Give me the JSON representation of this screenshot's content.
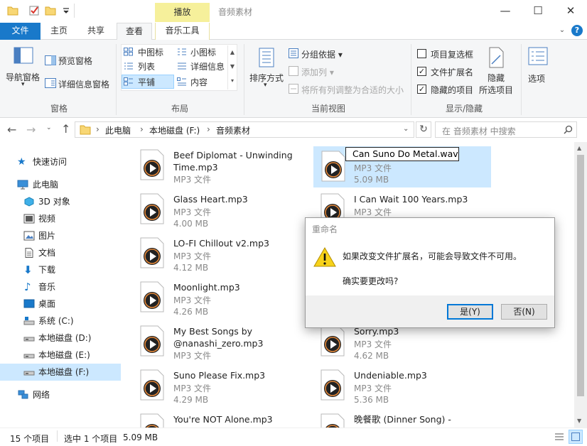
{
  "titlebar": {
    "context_tab": "播放",
    "window_title": "音频素材",
    "minimize": "—",
    "maximize": "☐",
    "close": "✕"
  },
  "ribbon_tabs": {
    "file": "文件",
    "home": "主页",
    "share": "共享",
    "view": "查看",
    "music_tools": "音乐工具"
  },
  "ribbon": {
    "panes": {
      "nav_pane": "导航窗格",
      "preview_pane": "预览窗格",
      "details_pane": "详细信息窗格",
      "label": "窗格"
    },
    "layout": {
      "medium_icons": "中图标",
      "small_icons": "小图标",
      "list": "列表",
      "details": "详细信息",
      "tiles": "平铺",
      "content": "内容",
      "label": "布局"
    },
    "current_view": {
      "sort_by": "排序方式",
      "group_by": "分组依据",
      "add_columns": "添加列",
      "size_all_columns": "将所有列调整为合适的大小",
      "label": "当前视图"
    },
    "show_hide": {
      "item_checkboxes": "项目复选框",
      "file_extensions": "文件扩展名",
      "hidden_items": "隐藏的项目",
      "hide_selected_line1": "隐藏",
      "hide_selected_line2": "所选项目",
      "label": "显示/隐藏",
      "item_checkboxes_checked": false,
      "file_extensions_checked": true,
      "hidden_items_checked": true
    },
    "options": "选项"
  },
  "address": {
    "crumbs": [
      "此电脑",
      "本地磁盘 (F:)",
      "音频素材"
    ],
    "separator": "›",
    "search_placeholder": "在 音频素材 中搜索"
  },
  "nav": {
    "quick_access": "快速访问",
    "this_pc": "此电脑",
    "objects3d": "3D 对象",
    "videos": "视频",
    "pictures": "图片",
    "documents": "文档",
    "downloads": "下载",
    "music": "音乐",
    "desktop": "桌面",
    "system_c": "系统 (C:)",
    "disk_d": "本地磁盘 (D:)",
    "disk_e": "本地磁盘 (E:)",
    "disk_f": "本地磁盘 (F:)",
    "network": "网络"
  },
  "files": {
    "col1": [
      {
        "name": "Beef Diplomat - Unwinding Time.mp3",
        "type": "MP3 文件",
        "size": ""
      },
      {
        "name": "Glass Heart.mp3",
        "type": "MP3 文件",
        "size": "4.00 MB"
      },
      {
        "name": "LO-FI Chillout v2.mp3",
        "type": "MP3 文件",
        "size": "4.12 MB"
      },
      {
        "name": "Moonlight.mp3",
        "type": "MP3 文件",
        "size": "4.26 MB"
      },
      {
        "name": "My Best Songs by @nanashi_zero.mp3",
        "type": "MP3 文件",
        "size": ""
      },
      {
        "name": "Suno Please Fix.mp3",
        "type": "MP3 文件",
        "size": "4.29 MB"
      },
      {
        "name": "You're NOT Alone.mp3",
        "type": "MP3 文件",
        "size": ""
      }
    ],
    "col2": [
      {
        "name": "Can Suno Do Metal.wav",
        "type": "MP3 文件",
        "size": "5.09 MB"
      },
      {
        "name": "I Can Wait 100 Years.mp3",
        "type": "MP3 文件",
        "size": ""
      },
      {
        "name": "Sorry.mp3",
        "type": "MP3 文件",
        "size": "4.62 MB"
      },
      {
        "name": "Undeniable.mp3",
        "type": "MP3 文件",
        "size": "5.36 MB"
      },
      {
        "name": "晚餐歌 (Dinner Song) - Remix",
        "type": "",
        "size": ""
      }
    ]
  },
  "status": {
    "count": "15 个项目",
    "selection": "选中 1 个项目",
    "selection_size": "5.09 MB"
  },
  "dialog": {
    "title": "重命名",
    "message": "如果改变文件扩展名，可能会导致文件不可用。",
    "question": "确实要更改吗?",
    "yes": "是(Y)",
    "no": "否(N)"
  },
  "colors": {
    "accent": "#1979ca",
    "selection": "#cce8ff",
    "context_tab": "#f6f09b"
  }
}
